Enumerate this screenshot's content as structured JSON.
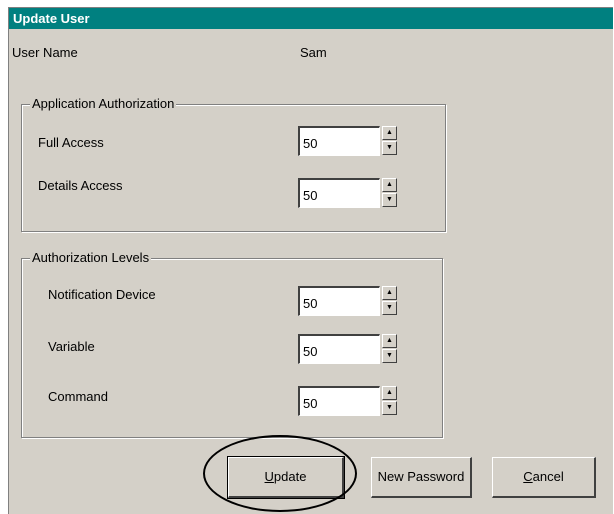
{
  "window": {
    "title": "Update User"
  },
  "user": {
    "label": "User Name",
    "value": "Sam"
  },
  "app_auth": {
    "title": "Application Authorization",
    "fields": [
      {
        "label": "Full Access",
        "value": "50"
      },
      {
        "label": "Details Access",
        "value": "50"
      }
    ]
  },
  "auth_levels": {
    "title": "Authorization Levels",
    "fields": [
      {
        "label": "Notification Device",
        "value": "50"
      },
      {
        "label": "Variable",
        "value": "50"
      },
      {
        "label": "Command",
        "value": "50"
      }
    ]
  },
  "buttons": {
    "update": {
      "accel": "U",
      "rest": "pdate"
    },
    "new_password": "New Password",
    "cancel": {
      "accel": "C",
      "rest": "ancel"
    }
  },
  "icons": {
    "spin_up": "▲",
    "spin_down": "▼"
  },
  "colors": {
    "titlebar": "#008080",
    "dialog": "#d4d0c8"
  }
}
